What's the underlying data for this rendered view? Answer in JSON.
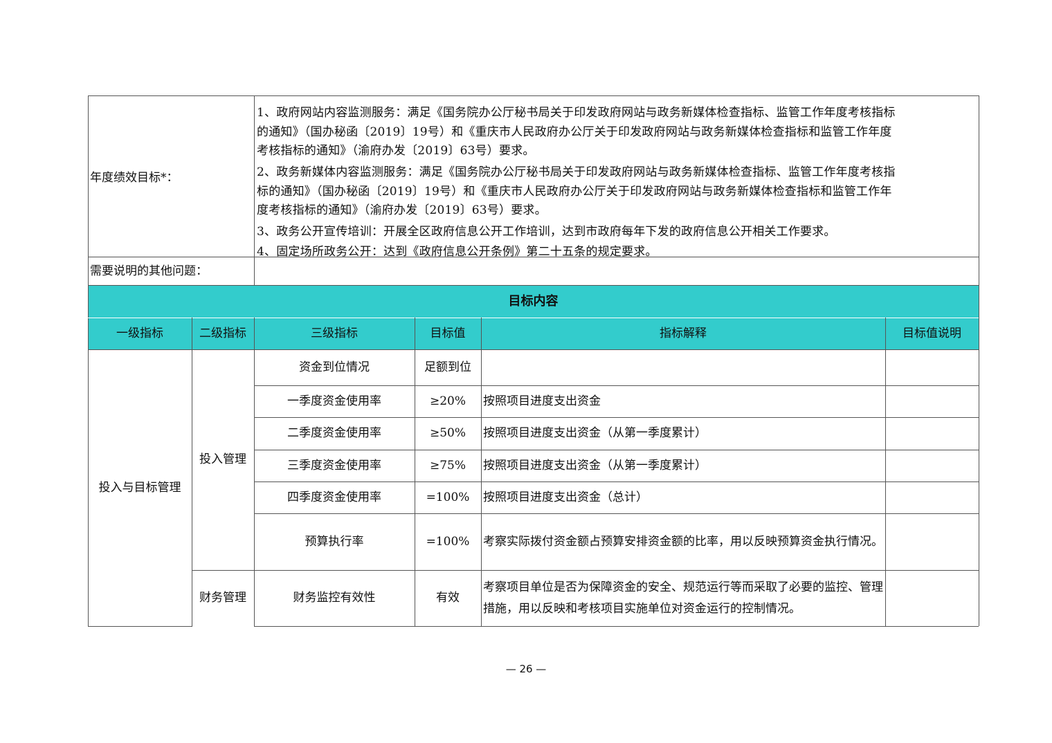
{
  "top": {
    "goal_label": "年度绩效目标*：",
    "goal_lines": [
      "1、政府网站内容监测服务：满足《国务院办公厅秘书局关于印发政府网站与政务新媒体检查指标、监管工作年度考核指标",
      "的通知》（国办秘函〔2019〕19号）和《重庆市人民政府办公厅关于印发政府网站与政务新媒体检查指标和监管工作年度",
      "考核指标的通知》（渝府办发〔2019〕63号）要求。",
      "2、政务新媒体内容监测服务：满足《国务院办公厅秘书局关于印发政府网站与政务新媒体检查指标、监管工作年度考核指",
      "标的通知》（国办秘函〔2019〕19号）和《重庆市人民政府办公厅关于印发政府网站与政务新媒体检查指标和监管工作年",
      "度考核指标的通知》（渝府办发〔2019〕63号）要求。",
      "3、政务公开宣传培训：开展全区政府信息公开工作培训，达到市政府每年下发的政府信息公开相关工作要求。",
      "4、固定场所政务公开：达到《政府信息公开条例》第二十五条的规定要求。"
    ],
    "other_label": "需要说明的其他问题："
  },
  "section_title": "目标内容",
  "columns": [
    "一级指标",
    "二级指标",
    "三级指标",
    "目标值",
    "指标解释",
    "目标值说明"
  ],
  "level1": "投入与目标管理",
  "level2": [
    "投入管理",
    "财务管理"
  ],
  "rows": [
    {
      "l3": "资金到位情况",
      "target": "足额到位",
      "explain": "",
      "note": ""
    },
    {
      "l3": "一季度资金使用率",
      "target": "≥20%",
      "explain": "按照项目进度支出资金",
      "note": ""
    },
    {
      "l3": "二季度资金使用率",
      "target": "≥50%",
      "explain": "按照项目进度支出资金（从第一季度累计）",
      "note": ""
    },
    {
      "l3": "三季度资金使用率",
      "target": "≥75%",
      "explain": "按照项目进度支出资金（从第一季度累计）",
      "note": ""
    },
    {
      "l3": "四季度资金使用率",
      "target": "=100%",
      "explain": "按照项目进度支出资金（总计）",
      "note": ""
    },
    {
      "l3": "预算执行率",
      "target": "=100%",
      "explain": "考察实际拨付资金额占预算安排资金额的比率，用以反映预算资金执行情况。",
      "note": ""
    },
    {
      "l3": "财务监控有效性",
      "target": "有效",
      "explain": "考察项目单位是否为保障资金的安全、规范运行等而采取了必要的监控、管理措施，用以反映和考核项目实施单位对资金运行的控制情况。",
      "note": ""
    }
  ],
  "page_number": "— 26 —"
}
